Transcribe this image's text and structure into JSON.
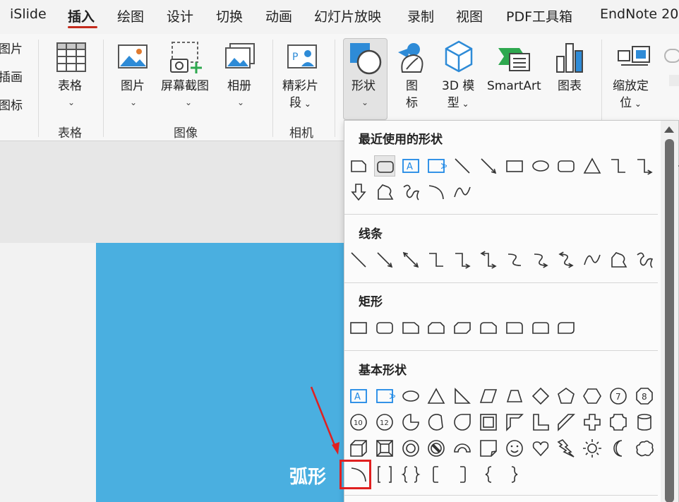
{
  "tabs": [
    "iSlide",
    "插入",
    "绘图",
    "设计",
    "切换",
    "动画",
    "幻灯片放映",
    "录制",
    "视图",
    "PDF工具箱",
    "EndNote 20"
  ],
  "active_tab": "插入",
  "ribbon": {
    "left_items": [
      "图片",
      "插画",
      "图标"
    ],
    "table_btn": "表格",
    "table_group": "表格",
    "picture_btn": "图片",
    "screenshot_btn": "屏幕截图",
    "album_btn": "相册",
    "image_group": "图像",
    "clip_btn_line1": "精彩片",
    "clip_btn_line2": "段",
    "camera_group": "相机",
    "shapes_btn": "形状",
    "icons_btn_line1": "图",
    "icons_btn_line2": "标",
    "model_btn_line1": "3D 模",
    "model_btn_line2": "型",
    "smartart_btn": "SmartArt",
    "chart_btn": "图表",
    "zoom_btn_line1": "缩放定",
    "zoom_btn_line2": "位"
  },
  "dropdown": {
    "sections": [
      {
        "title": "最近使用的形状",
        "shapes": [
          "snip-rect",
          "rounded-rect",
          "textbox-h",
          "textbox-v",
          "line",
          "arrow-line",
          "rectangle",
          "oval",
          "rounded-rect",
          "triangle",
          "elbow-connector",
          "elbow-arrow-connector",
          "right-arrow",
          "down-arrow",
          "freeform",
          "scribble",
          "arc",
          "curve"
        ]
      },
      {
        "title": "线条",
        "shapes": [
          "line",
          "arrow-line",
          "double-arrow-line",
          "elbow-connector",
          "elbow-arrow-connector",
          "elbow-double-arrow",
          "curved-connector",
          "curved-arrow-connector",
          "curved-double-arrow",
          "curve",
          "freeform",
          "scribble"
        ]
      },
      {
        "title": "矩形",
        "shapes": [
          "rectangle",
          "rounded-rect",
          "snip-single-corner",
          "snip-same-side",
          "snip-diagonal",
          "snip-round-single",
          "round-single-corner",
          "round-same-side",
          "round-diagonal"
        ]
      },
      {
        "title": "基本形状",
        "shapes": [
          "textbox-h",
          "textbox-v",
          "oval",
          "triangle",
          "right-triangle",
          "parallelogram",
          "trapezoid",
          "diamond",
          "pentagon",
          "hexagon",
          "heptagon-7",
          "octagon-8",
          "decagon-10",
          "dodecagon-12",
          "pie",
          "chord",
          "teardrop",
          "frame",
          "half-frame",
          "l-shape",
          "diagonal-stripe",
          "plus",
          "plaque",
          "can",
          "cube",
          "bevel",
          "donut",
          "no-symbol",
          "block-arc",
          "folded-corner",
          "smiley-face",
          "heart",
          "lightning-bolt",
          "sun",
          "moon",
          "cloud",
          "arc",
          "double-bracket",
          "double-brace",
          "left-bracket",
          "right-bracket",
          "left-brace",
          "right-brace"
        ]
      }
    ]
  },
  "annotation": {
    "label": "弧形",
    "box_color": "#e02020"
  },
  "colors": {
    "slide": "#4aafe0",
    "tab_underline": "#c42b1c",
    "accent_blue": "#1e88e5"
  }
}
